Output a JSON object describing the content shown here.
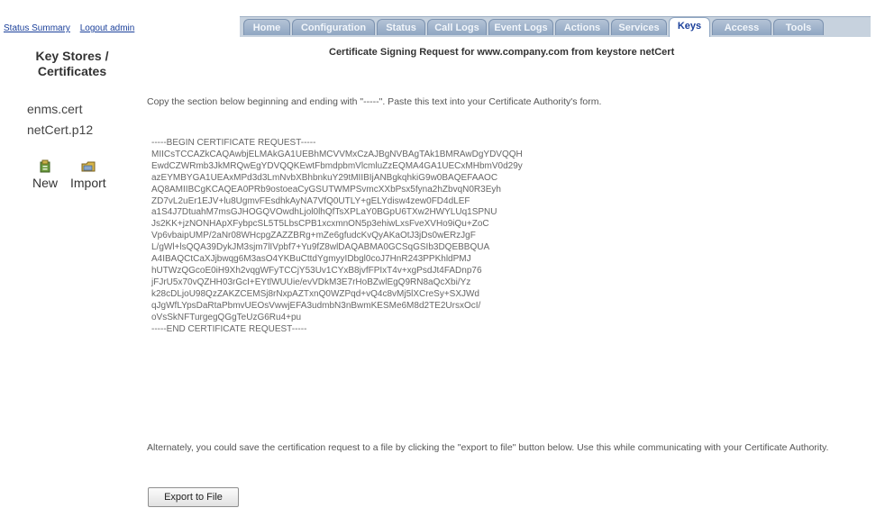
{
  "top_links": {
    "status_summary": "Status Summary",
    "logout": "Logout admin"
  },
  "tabs": [
    {
      "label": "Home",
      "active": false
    },
    {
      "label": "Configuration",
      "active": false
    },
    {
      "label": "Status",
      "active": false
    },
    {
      "label": "Call Logs",
      "active": false
    },
    {
      "label": "Event Logs",
      "active": false
    },
    {
      "label": "Actions",
      "active": false
    },
    {
      "label": "Services",
      "active": false
    },
    {
      "label": "Keys",
      "active": true
    },
    {
      "label": "Access",
      "active": false
    },
    {
      "label": "Tools",
      "active": false
    }
  ],
  "sidebar": {
    "title_line1": "Key Stores /",
    "title_line2": "Certificates",
    "items": [
      {
        "label": "enms.cert"
      },
      {
        "label": "netCert.p12"
      }
    ],
    "actions": [
      {
        "label": "New",
        "icon": "new-keystore-icon"
      },
      {
        "label": "Import",
        "icon": "import-folder-icon"
      }
    ]
  },
  "main": {
    "title": "Certificate Signing Request for www.company.com from keystore netCert",
    "intro": "Copy the section below beginning and ending with \"-----\". Paste this text into your Certificate Authority's form.",
    "csr": "-----BEGIN CERTIFICATE REQUEST-----\nMIICsTCCAZkCAQAwbjELMAkGA1UEBhMCVVMxCzAJBgNVBAgTAk1BMRAwDgYDVQQH\nEwdCZWRmb3JkMRQwEgYDVQQKEwtFbmdpbmVlcmluZzEQMA4GA1UECxMHbmV0d29y\nazEYMBYGA1UEAxMPd3d3LmNvbXBhbnkuY29tMIIBIjANBgkqhkiG9w0BAQEFAAOC\nAQ8AMIIBCgKCAQEA0PRb9ostoeaCyGSUTWMPSvmcXXbPsx5fyna2hZbvqN0R3Eyh\nZD7vL2uEr1EJV+lu8UgmvFEsdhkAyNA7VfQ0UTLY+gELYdisw4zew0FD4dLEF\na1S4J7DtuahM7msGJHOGQVOwdhLjol0lhQfTsXPLaY0BGpU6TXw2HWYLUq1SPNU\nJs2KK+jzNONHApXFybpcSL5T5LbsCPB1xcxmnON5p3ehiwLxsFveXVHo9iQu+ZoC\nVp6vbaipUMP/2aNr08WHcpgZAZZBRg+mZe6gfudcKvQyAKaOtJ3jDs0wERzJgF\nL/gWl+lsQQA39DykJM3sjm7lIVpbf7+Yu9fZ8wlDAQABMA0GCSqGSIb3DQEBBQUA\nA4IBAQCtCaXJjbwqg6M3asO4YKBuCttdYgmyyIDbgl0coJ7HnR243PPKhldPMJ\nhUTWzQGcoE0iH9Xh2vqgWFyTCCjY53Uv1CYxB8jvfFPIxT4v+xgPsdJt4FADnp76\njFJrU5x70vQZHH03rGcI+EYtlWUUie/evVDkM3E7rHoBZwlEgQ9RN8aQcXbi/Yz\nk28cDLjoU98QzZAKZCEMSj8rNxpAZTxnQ0WZPqd+vQ4c8vMj5lXCreSy+SXJWd\nqJgWfLYpsDaRtaPbmvUEOsVwwjEFA3udmbN3nBwmKESMe6M8d2TE2UrsxOcI/\noVsSkNFTurgegQGgTeUzG6Ru4+pu\n-----END CERTIFICATE REQUEST-----",
    "alternate": "Alternately, you could save the certification request to a file by clicking the \"export to file\" button below. Use this while communicating with your Certificate Authority.",
    "export_button": "Export to File"
  }
}
